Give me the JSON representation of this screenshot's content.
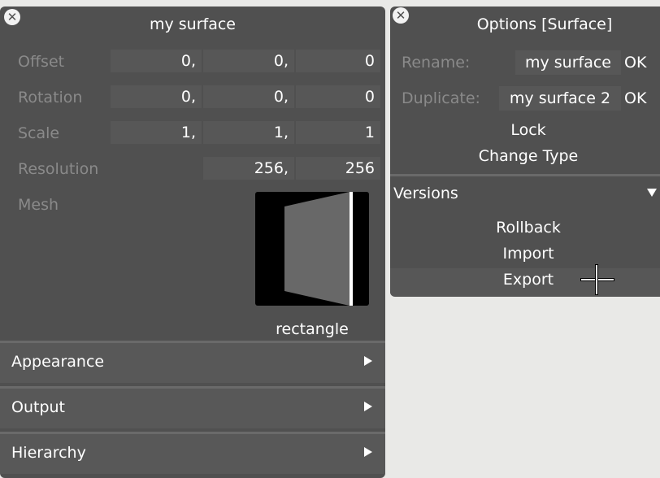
{
  "surface_panel": {
    "title": "my surface",
    "rows": {
      "offset": {
        "label": "Offset",
        "values": [
          "0,",
          "0,",
          "0"
        ]
      },
      "rotation": {
        "label": "Rotation",
        "values": [
          "0,",
          "0,",
          "0"
        ]
      },
      "scale": {
        "label": "Scale",
        "values": [
          "1,",
          "1,",
          "1"
        ]
      },
      "resolution": {
        "label": "Resolution",
        "values": [
          "256,",
          "256"
        ]
      },
      "mesh": {
        "label": "Mesh",
        "value": "rectangle"
      }
    },
    "sections": [
      "Appearance",
      "Output",
      "Hierarchy"
    ]
  },
  "options_panel": {
    "title": "Options [Surface]",
    "rename": {
      "label": "Rename:",
      "value": "my surface",
      "ok": "OK"
    },
    "duplicate": {
      "label": "Duplicate:",
      "value": "my surface 2",
      "ok": "OK"
    },
    "lock": "Lock",
    "change_type": "Change Type",
    "versions": {
      "label": "Versions",
      "items": [
        "Rollback",
        "Import",
        "Export"
      ]
    }
  },
  "colors": {
    "background": "#e9e9e7",
    "panel": "#505050",
    "field": "#575757",
    "label_dim": "#8a8a8a",
    "text": "#ffffff"
  },
  "icons": [
    "close-icon",
    "chevron-right-icon",
    "chevron-down-icon",
    "crosshair-cursor-icon"
  ]
}
